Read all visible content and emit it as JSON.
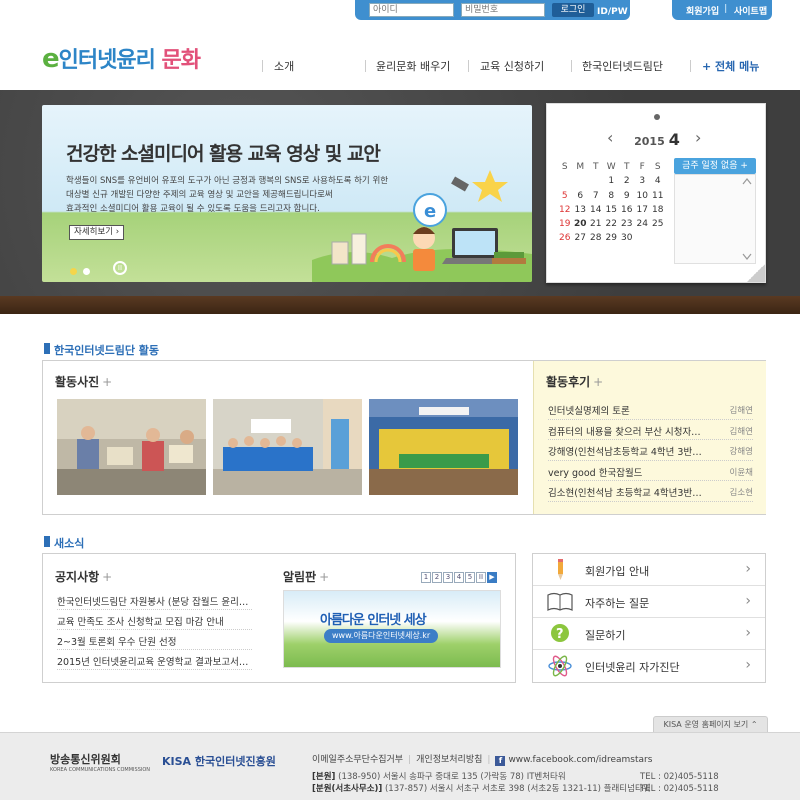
{
  "topbar": {
    "id_placeholder": "아이디",
    "pw_placeholder": "비밀번호",
    "login_button": "로그인",
    "find_link": "ID/PW 찾기",
    "join_link": "회원가입",
    "sitemap_link": "사이트맵"
  },
  "header": {
    "logo_e": "e",
    "logo_text": "인터넷윤리 ",
    "logo_mun": "문화",
    "gnb": [
      "소개",
      "윤리문화 배우기",
      "교육 신청하기",
      "한국인터넷드림단"
    ],
    "all_menu": "+ 전체 메뉴"
  },
  "banner": {
    "title": "건강한 소셜미디어 활용 교육 영상 및 교안",
    "desc_lines": [
      "학생들이 SNS를 유언비어 유포의 도구가 아닌 긍정과 행복의 SNS로 사용하도록 하기 위한",
      "대상별 신규 개발된 다양한 주제의 교육 영상 및 교안을 제공해드립니다로써",
      "효과적인 소셜미디어 활용 교육이 될 수 있도록 도움을 드리고자 합니다."
    ],
    "more": "자세히보기 ›",
    "pause": "II"
  },
  "calendar": {
    "year": "2015",
    "month": "4",
    "prev": "‹",
    "next": "›",
    "weekdays": [
      "S",
      "M",
      "T",
      "W",
      "T",
      "F",
      "S"
    ],
    "weeks": [
      [
        "",
        "",
        "",
        "1",
        "2",
        "3",
        "4"
      ],
      [
        "5",
        "6",
        "7",
        "8",
        "9",
        "10",
        "11"
      ],
      [
        "12",
        "13",
        "14",
        "15",
        "16",
        "17",
        "18"
      ],
      [
        "19",
        "20",
        "21",
        "22",
        "23",
        "24",
        "25"
      ],
      [
        "26",
        "27",
        "28",
        "29",
        "30",
        "",
        ""
      ]
    ],
    "week_label": "금주 일정 없음 +"
  },
  "activity": {
    "section_title": "한국인터넷드림단 활동",
    "photo_title": "활동사진",
    "plus": "+",
    "review_title": "활동후기",
    "reviews": [
      {
        "title": "인터넷실명제의 토론",
        "author": "김해연"
      },
      {
        "title": "컴퓨터의 내용을 찾으러 부산 시청자…",
        "author": "김해연"
      },
      {
        "title": "강해영(인천석남초등학교 4학년 3반…",
        "author": "강해영"
      },
      {
        "title": "very good 한국잡월드",
        "author": "이윤채"
      },
      {
        "title": "김소현(인천석남 초등학교 4학년3반…",
        "author": "김소현"
      }
    ]
  },
  "news": {
    "section_title": "새소식",
    "notice_title": "공지사항",
    "notices": [
      "한국인터넷드림단 자원봉사 (분당 잡월드 윤리…",
      "교육 만족도 조사 신청학교 모집 마감 안내",
      "2~3월 토론회 우수 단원 선정",
      "2015년 인터넷윤리교육 운영학교 결과보고서…"
    ],
    "board_title": "알림판",
    "pages": [
      "1",
      "2",
      "3",
      "4",
      "5",
      "II",
      "▶"
    ],
    "board_banner_text": "아름다운 인터넷 세상",
    "board_banner_url": "www.아름다운인터넷세상.kr"
  },
  "quick": [
    {
      "label": "회원가입 안내",
      "icon": "pencil-icon"
    },
    {
      "label": "자주하는 질문",
      "icon": "book-icon"
    },
    {
      "label": "질문하기",
      "icon": "question-icon"
    },
    {
      "label": "인터넷윤리 자가진단",
      "icon": "atom-icon"
    }
  ],
  "footer": {
    "kisa_tab": "KISA 운영 홈페이지 보기 ⌃",
    "logo1": "방송통신위원회",
    "logo1_sub": "KOREA COMMUNICATIONS COMMISSION",
    "logo2": "KISA 한국인터넷진흥원",
    "link1": "이메일주소무단수집거부",
    "link2": "개인정보처리방침",
    "facebook": "www.facebook.com/idreamstars",
    "addr1_label": "[본원]",
    "addr1": " (138-950) 서울시 송파구 중대로 135 (가락동 78) IT벤처타워",
    "addr2_label": "[분원(서초사무소)]",
    "addr2": " (137-857) 서울시 서초구 서초로 398 (서초2동 1321-11) 플래티넘타워",
    "tel1": "TEL : 02)405-5118",
    "tel2": "TEL : 02)405-5118"
  },
  "colors": {
    "brand_blue": "#3f8fcf",
    "section_blue": "#2d6fb7",
    "review_bg": "#fdf9dc"
  }
}
